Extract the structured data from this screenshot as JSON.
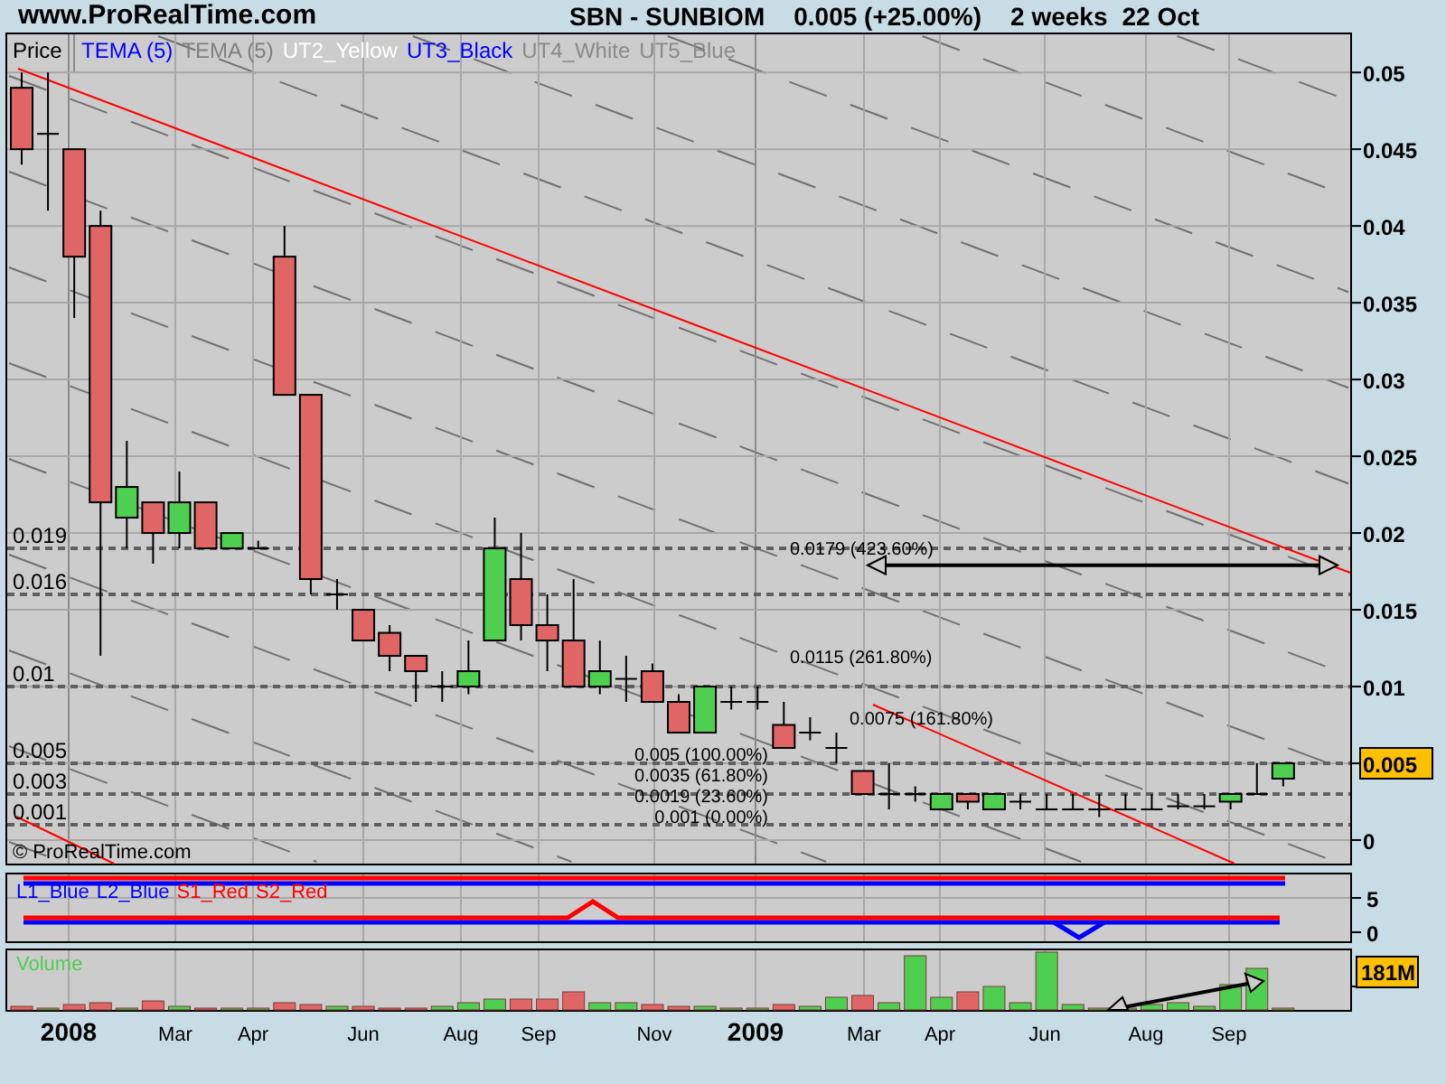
{
  "header": {
    "site": "www.ProRealTime.com",
    "symbol": "SBN - SUNBIOM",
    "quote": "0.005 (+25.00%)",
    "period": "2 weeks",
    "date": "22 Oct"
  },
  "price_panel": {
    "legend": [
      {
        "text": "Price",
        "color": "#000000"
      },
      {
        "text": "TEMA (5)",
        "color": "#0000ff"
      },
      {
        "text": "TEMA (5)",
        "color": "#808080"
      },
      {
        "text": "UT2_Yellow",
        "color": "#ffffff"
      },
      {
        "text": "UT3_Black",
        "color": "#0000ff"
      },
      {
        "text": "UT4_White",
        "color": "#8a8a8a"
      },
      {
        "text": "UT5_Blue",
        "color": "#8a8a8a"
      }
    ],
    "level_labels": [
      "0.019",
      "0.016",
      "0.01",
      "0.005",
      "0.003",
      "0.001"
    ],
    "fib_labels": [
      "0.0179 (423.60%)",
      "0.0115 (261.80%)",
      "0.0075 (161.80%)",
      "0.005 (100.00%)",
      "0.0035 (61.80%)",
      "0.0019 (23.60%)",
      "0.001 (0.00%)"
    ],
    "copyright": "© ProRealTime.com",
    "y_axis": [
      "0.05",
      "0.045",
      "0.04",
      "0.035",
      "0.03",
      "0.025",
      "0.02",
      "0.015",
      "0.01",
      "0"
    ],
    "current_price": "0.005",
    "chart_data": {
      "type": "candlestick",
      "grid": true,
      "yticks": [
        0,
        0.005,
        0.01,
        0.015,
        0.02,
        0.025,
        0.03,
        0.035,
        0.04,
        0.045,
        0.05
      ],
      "ylim": [
        -0.00165,
        0.0526
      ],
      "ohlc": [
        [
          0.049,
          0.05,
          0.044,
          0.045
        ],
        [
          0.046,
          0.05,
          0.041,
          0.046
        ],
        [
          0.045,
          0.045,
          0.034,
          0.038
        ],
        [
          0.04,
          0.041,
          0.012,
          0.022
        ],
        [
          0.021,
          0.026,
          0.019,
          0.023
        ],
        [
          0.022,
          0.022,
          0.018,
          0.02
        ],
        [
          0.02,
          0.024,
          0.019,
          0.022
        ],
        [
          0.022,
          0.022,
          0.019,
          0.019
        ],
        [
          0.019,
          0.02,
          0.019,
          0.02
        ],
        [
          0.019,
          0.0195,
          0.019,
          0.019
        ],
        [
          0.038,
          0.04,
          0.029,
          0.029
        ],
        [
          0.029,
          0.029,
          0.016,
          0.017
        ],
        [
          0.016,
          0.017,
          0.015,
          0.016
        ],
        [
          0.015,
          0.015,
          0.013,
          0.013
        ],
        [
          0.0135,
          0.014,
          0.011,
          0.012
        ],
        [
          0.012,
          0.012,
          0.009,
          0.011
        ],
        [
          0.01,
          0.011,
          0.009,
          0.01
        ],
        [
          0.01,
          0.013,
          0.0095,
          0.011
        ],
        [
          0.013,
          0.021,
          0.013,
          0.019
        ],
        [
          0.017,
          0.02,
          0.013,
          0.014
        ],
        [
          0.014,
          0.016,
          0.011,
          0.013
        ],
        [
          0.013,
          0.017,
          0.01,
          0.01
        ],
        [
          0.01,
          0.013,
          0.0095,
          0.011
        ],
        [
          0.0105,
          0.012,
          0.009,
          0.0105
        ],
        [
          0.011,
          0.0115,
          0.009,
          0.009
        ],
        [
          0.009,
          0.0095,
          0.007,
          0.007
        ],
        [
          0.007,
          0.01,
          0.007,
          0.01
        ],
        [
          0.009,
          0.01,
          0.0085,
          0.009
        ],
        [
          0.009,
          0.01,
          0.0085,
          0.009
        ],
        [
          0.0075,
          0.009,
          0.006,
          0.006
        ],
        [
          0.007,
          0.008,
          0.0065,
          0.007
        ],
        [
          0.006,
          0.007,
          0.005,
          0.006
        ],
        [
          0.0045,
          0.0045,
          0.003,
          0.003
        ],
        [
          0.003,
          0.005,
          0.002,
          0.003
        ],
        [
          0.003,
          0.0035,
          0.0025,
          0.003
        ],
        [
          0.002,
          0.003,
          0.002,
          0.003
        ],
        [
          0.003,
          0.003,
          0.002,
          0.0025
        ],
        [
          0.002,
          0.003,
          0.002,
          0.003
        ],
        [
          0.0025,
          0.003,
          0.002,
          0.0025
        ],
        [
          0.002,
          0.003,
          0.002,
          0.002
        ],
        [
          0.002,
          0.003,
          0.002,
          0.002
        ],
        [
          0.002,
          0.003,
          0.0015,
          0.002
        ],
        [
          0.002,
          0.003,
          0.002,
          0.002
        ],
        [
          0.002,
          0.003,
          0.002,
          0.002
        ],
        [
          0.0022,
          0.003,
          0.002,
          0.0022
        ],
        [
          0.0022,
          0.003,
          0.002,
          0.0022
        ],
        [
          0.0025,
          0.003,
          0.002,
          0.003
        ],
        [
          0.003,
          0.005,
          0.003,
          0.003
        ],
        [
          0.004,
          0.005,
          0.0035,
          0.005
        ]
      ]
    }
  },
  "oscillator_panel": {
    "legend": [
      {
        "text": "L1_Blue",
        "color": "#0000ff"
      },
      {
        "text": "L2_Blue",
        "color": "#0000ff"
      },
      {
        "text": "S1_Red",
        "color": "#ff0000"
      },
      {
        "text": "S2_Red",
        "color": "#ff0000"
      }
    ],
    "y_axis": [
      "5",
      "0"
    ]
  },
  "volume_panel": {
    "title": "Volume",
    "current_volume": "181M"
  },
  "x_axis": [
    {
      "label": "2008",
      "kind": "year"
    },
    {
      "label": "Mar",
      "kind": "month"
    },
    {
      "label": "Apr",
      "kind": "month"
    },
    {
      "label": "Jun",
      "kind": "month"
    },
    {
      "label": "Aug",
      "kind": "month"
    },
    {
      "label": "Sep",
      "kind": "month"
    },
    {
      "label": "Nov",
      "kind": "month"
    },
    {
      "label": "2009",
      "kind": "year"
    },
    {
      "label": "Mar",
      "kind": "month"
    },
    {
      "label": "Apr",
      "kind": "month"
    },
    {
      "label": "Jun",
      "kind": "month"
    },
    {
      "label": "Aug",
      "kind": "month"
    },
    {
      "label": "Sep",
      "kind": "month"
    }
  ]
}
